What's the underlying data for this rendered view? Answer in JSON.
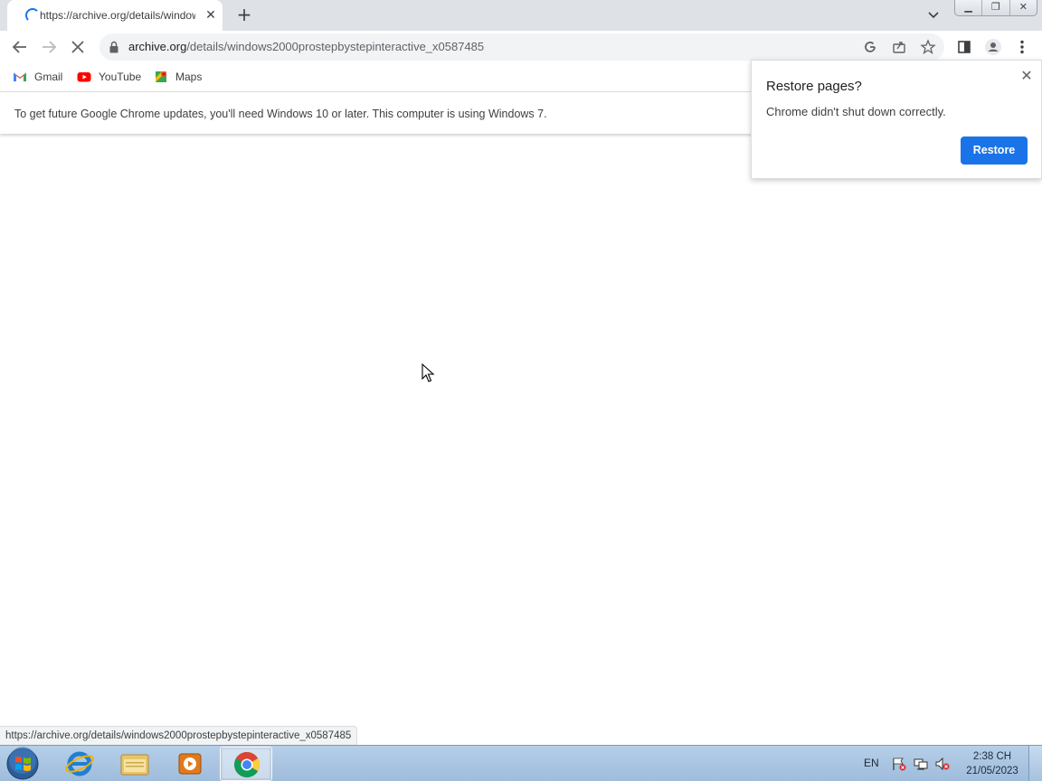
{
  "browser": {
    "tab": {
      "title": "https://archive.org/details/windows2000prostepbystepinteractive_x0587485",
      "loading": true
    },
    "toolbar": {
      "url_host": "archive.org",
      "url_path": "/details/windows2000prostepbystepinteractive_x0587485",
      "icons": [
        "back-icon",
        "forward-icon",
        "stop-icon",
        "lock-icon",
        "google-lens-icon",
        "share-icon",
        "bookmark-star-icon",
        "side-panel-icon",
        "profile-icon",
        "menu-icon"
      ]
    },
    "bookmarks": [
      {
        "label": "Gmail",
        "icon": "gmail-icon"
      },
      {
        "label": "YouTube",
        "icon": "youtube-icon"
      },
      {
        "label": "Maps",
        "icon": "maps-icon"
      }
    ],
    "infobar": {
      "message": "To get future Google Chrome updates, you'll need Windows 10 or later. This computer is using Windows 7."
    },
    "restore_bubble": {
      "title": "Restore pages?",
      "message": "Chrome didn't shut down correctly.",
      "button_label": "Restore"
    },
    "status_url": "https://archive.org/details/windows2000prostepbystepinteractive_x0587485"
  },
  "taskbar": {
    "apps": [
      "internet-explorer",
      "file-explorer",
      "media-player",
      "chrome"
    ],
    "active_app": "chrome",
    "tray": {
      "language": "EN",
      "time": "2:38 CH",
      "date": "21/05/2023"
    }
  },
  "colors": {
    "accent": "#1a73e8",
    "tabstrip": "#dee1e6",
    "taskbar": "#a9c4e0"
  }
}
